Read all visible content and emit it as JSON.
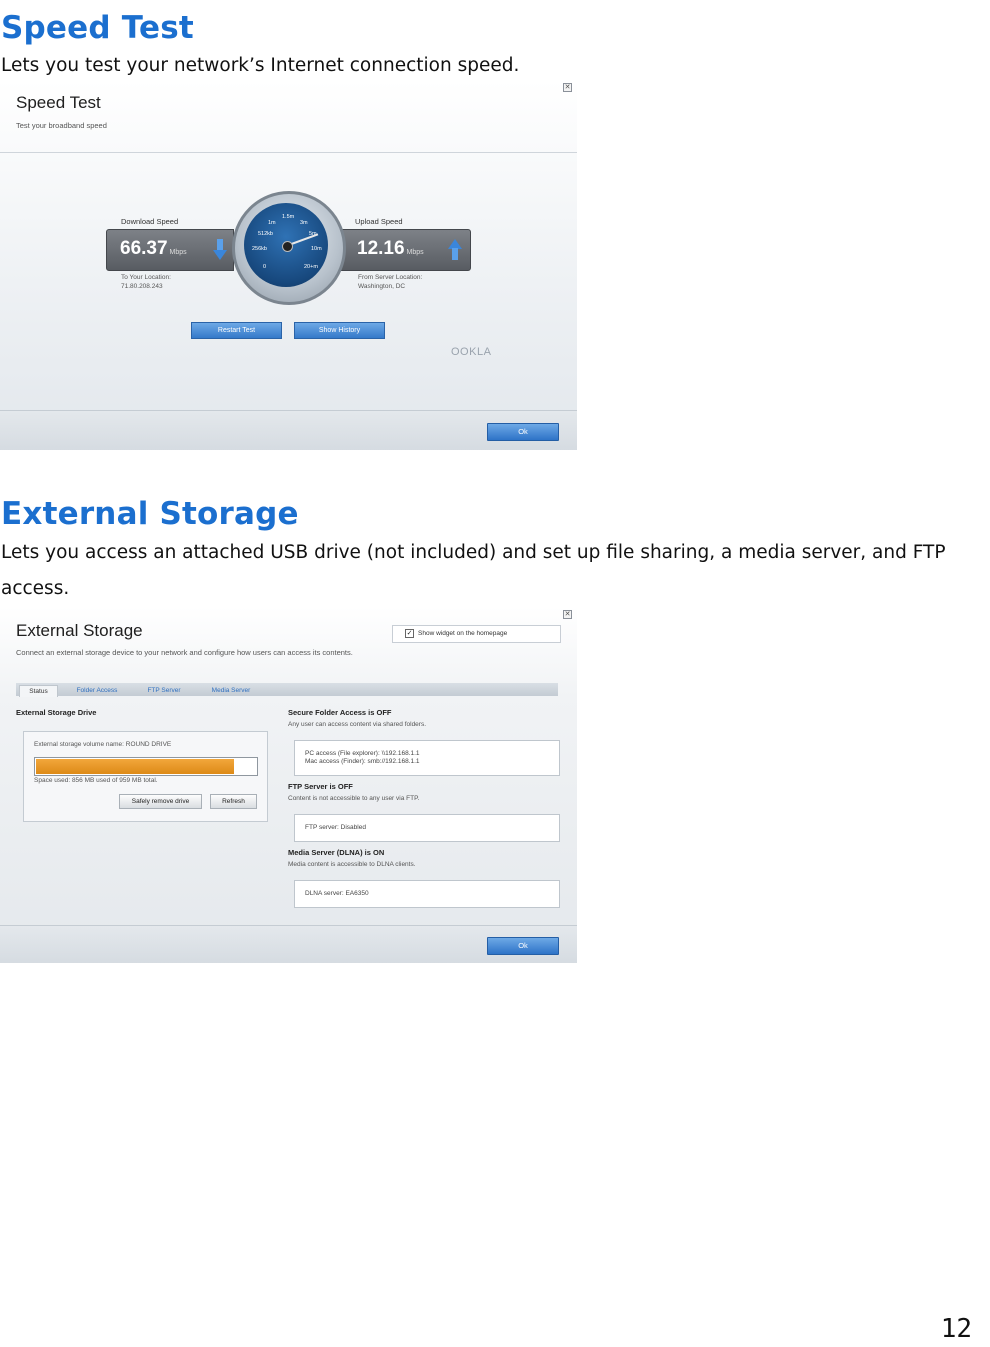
{
  "sections": {
    "speed": {
      "title": "Speed Test",
      "description": "Lets you test your network’s Internet connection speed."
    },
    "storage": {
      "title": "External Storage",
      "description_line1": "Lets you access an attached USB drive (not included) and set up file sharing, a media server, and FTP",
      "description_line2": "access."
    }
  },
  "speed_panel": {
    "title": "Speed Test",
    "subtitle": "Test your broadband speed",
    "download": {
      "label": "Download Speed",
      "value": "66.37",
      "unit": "Mbps",
      "location_label": "To Your Location:",
      "location_value": "71.80.208.243"
    },
    "upload": {
      "label": "Upload Speed",
      "value": "12.16",
      "unit": "Mbps",
      "location_label": "From Server Location:",
      "location_value": "Washington, DC"
    },
    "gauge_ticks": [
      "0",
      "256kb",
      "512kb",
      "1m",
      "1.5m",
      "3m",
      "5m",
      "10m",
      "20+m"
    ],
    "restart_label": "Restart Test",
    "history_label": "Show History",
    "brand": "OOKLA",
    "ok_label": "Ok",
    "close_glyph": "✕"
  },
  "storage_panel": {
    "title": "External Storage",
    "subtitle": "Connect an external storage device to your network and configure how users can access its contents.",
    "show_widget_label": "Show widget on the homepage",
    "check_glyph": "✓",
    "tabs": [
      "Status",
      "Folder Access",
      "FTP Server",
      "Media Server"
    ],
    "drive": {
      "heading": "External Storage Drive",
      "volume_name": "External storage volume name: ROUND DRIVE",
      "space_used": "Space used: 856 MB used of 959 MB total.",
      "usage_fraction": 0.89,
      "safely_remove_label": "Safely remove drive",
      "refresh_label": "Refresh"
    },
    "secure": {
      "heading": "Secure Folder Access is OFF",
      "desc": "Any user can access content via shared folders.",
      "pc_access": "PC access (File explorer): \\\\192.168.1.1",
      "mac_access": "Mac access (Finder): smb://192.168.1.1"
    },
    "ftp": {
      "heading": "FTP Server is OFF",
      "desc": "Content is not accessible to any user via FTP.",
      "status": "FTP server: Disabled"
    },
    "media": {
      "heading": "Media Server (DLNA) is ON",
      "desc": "Media content is accessible to DLNA clients.",
      "status": "DLNA server: EA6350"
    },
    "ok_label": "Ok",
    "close_glyph": "✕"
  },
  "page_number": "12",
  "colors": {
    "heading_blue": "#1b6fcf",
    "accent_orange": "#e8961f",
    "button_blue": "#3479c9"
  }
}
